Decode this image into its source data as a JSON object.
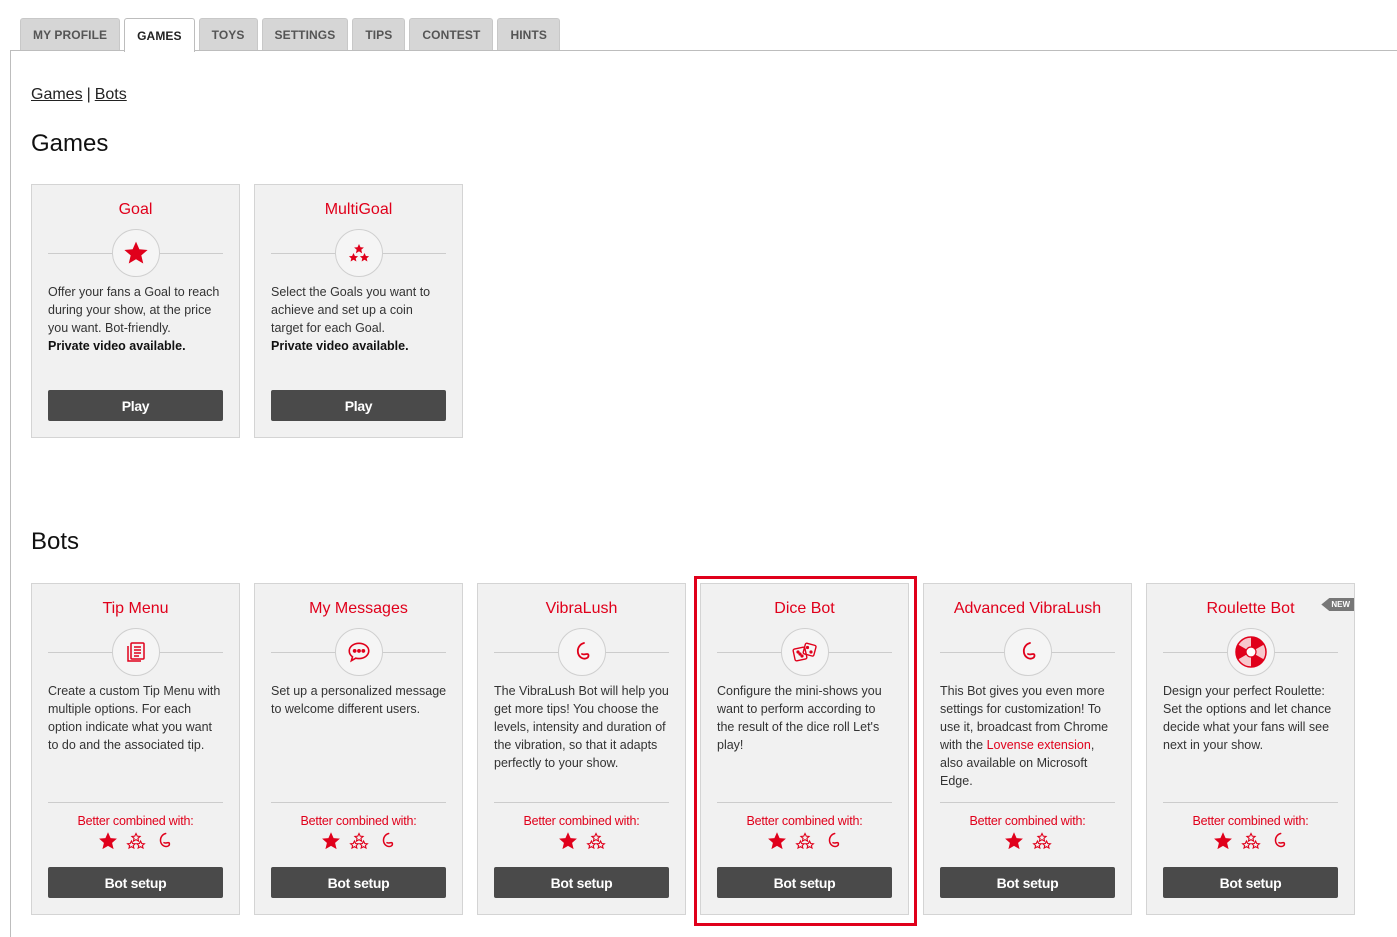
{
  "tabs": [
    {
      "label": "MY PROFILE",
      "active": false
    },
    {
      "label": "GAMES",
      "active": true
    },
    {
      "label": "TOYS",
      "active": false
    },
    {
      "label": "SETTINGS",
      "active": false
    },
    {
      "label": "TIPS",
      "active": false
    },
    {
      "label": "CONTEST",
      "active": false
    },
    {
      "label": "HINTS",
      "active": false
    }
  ],
  "breadcrumb": {
    "games": "Games",
    "sep": "|",
    "bots": "Bots"
  },
  "games_section": {
    "heading": "Games",
    "cards": [
      {
        "title": "Goal",
        "icon": "star-icon",
        "desc": "Offer your fans a Goal to reach during your show, at the price you want. Bot-friendly.",
        "desc_bold": "Private video available.",
        "button": "Play"
      },
      {
        "title": "MultiGoal",
        "icon": "multi-star-icon",
        "desc": "Select the Goals you want to achieve and set up a coin target for each Goal.",
        "desc_bold": "Private video available.",
        "button": "Play"
      }
    ]
  },
  "bots_section": {
    "heading": "Bots",
    "combined_label": "Better combined with:",
    "cards": [
      {
        "title": "Tip Menu",
        "icon": "menu-icon",
        "desc": "Create a custom Tip Menu with multiple options. For each option indicate what you want to do and the associated tip.",
        "button": "Bot setup",
        "combined": [
          "star-icon",
          "multi-star-icon",
          "vibrator-icon"
        ]
      },
      {
        "title": "My Messages",
        "icon": "chat-icon",
        "desc": "Set up a personalized message to welcome different users.",
        "button": "Bot setup",
        "combined": [
          "star-icon",
          "multi-star-icon",
          "vibrator-icon"
        ]
      },
      {
        "title": "VibraLush",
        "icon": "vibrator-icon",
        "desc": "The VibraLush Bot will help you get more tips! You choose the levels, intensity and duration of the vibration, so that it adapts perfectly to your show.",
        "button": "Bot setup",
        "combined": [
          "star-icon",
          "multi-star-icon"
        ]
      },
      {
        "title": "Dice Bot",
        "icon": "dice-icon",
        "desc": "Configure the mini-shows you want to perform according to the result of the dice roll Let's play!",
        "button": "Bot setup",
        "combined": [
          "star-icon",
          "multi-star-icon",
          "vibrator-icon"
        ]
      },
      {
        "title": "Advanced VibraLush",
        "icon": "vibrator-icon",
        "desc_pre": "This Bot gives you even more settings for customization! To use it, broadcast from Chrome with the ",
        "desc_link": "Lovense extension",
        "desc_post": ", also available on Microsoft Edge.",
        "button": "Bot setup",
        "combined": [
          "star-icon",
          "multi-star-icon"
        ]
      },
      {
        "title": "Roulette Bot",
        "icon": "roulette-icon",
        "badge": "NEW",
        "desc": "Design your perfect Roulette: Set the options and let chance decide what your fans will see next in your show.",
        "button": "Bot setup",
        "combined": [
          "star-icon",
          "multi-star-icon",
          "vibrator-icon"
        ]
      }
    ]
  },
  "colors": {
    "accent": "#e0001b",
    "button": "#4a4a4a",
    "card_bg": "#f1f1f1"
  }
}
